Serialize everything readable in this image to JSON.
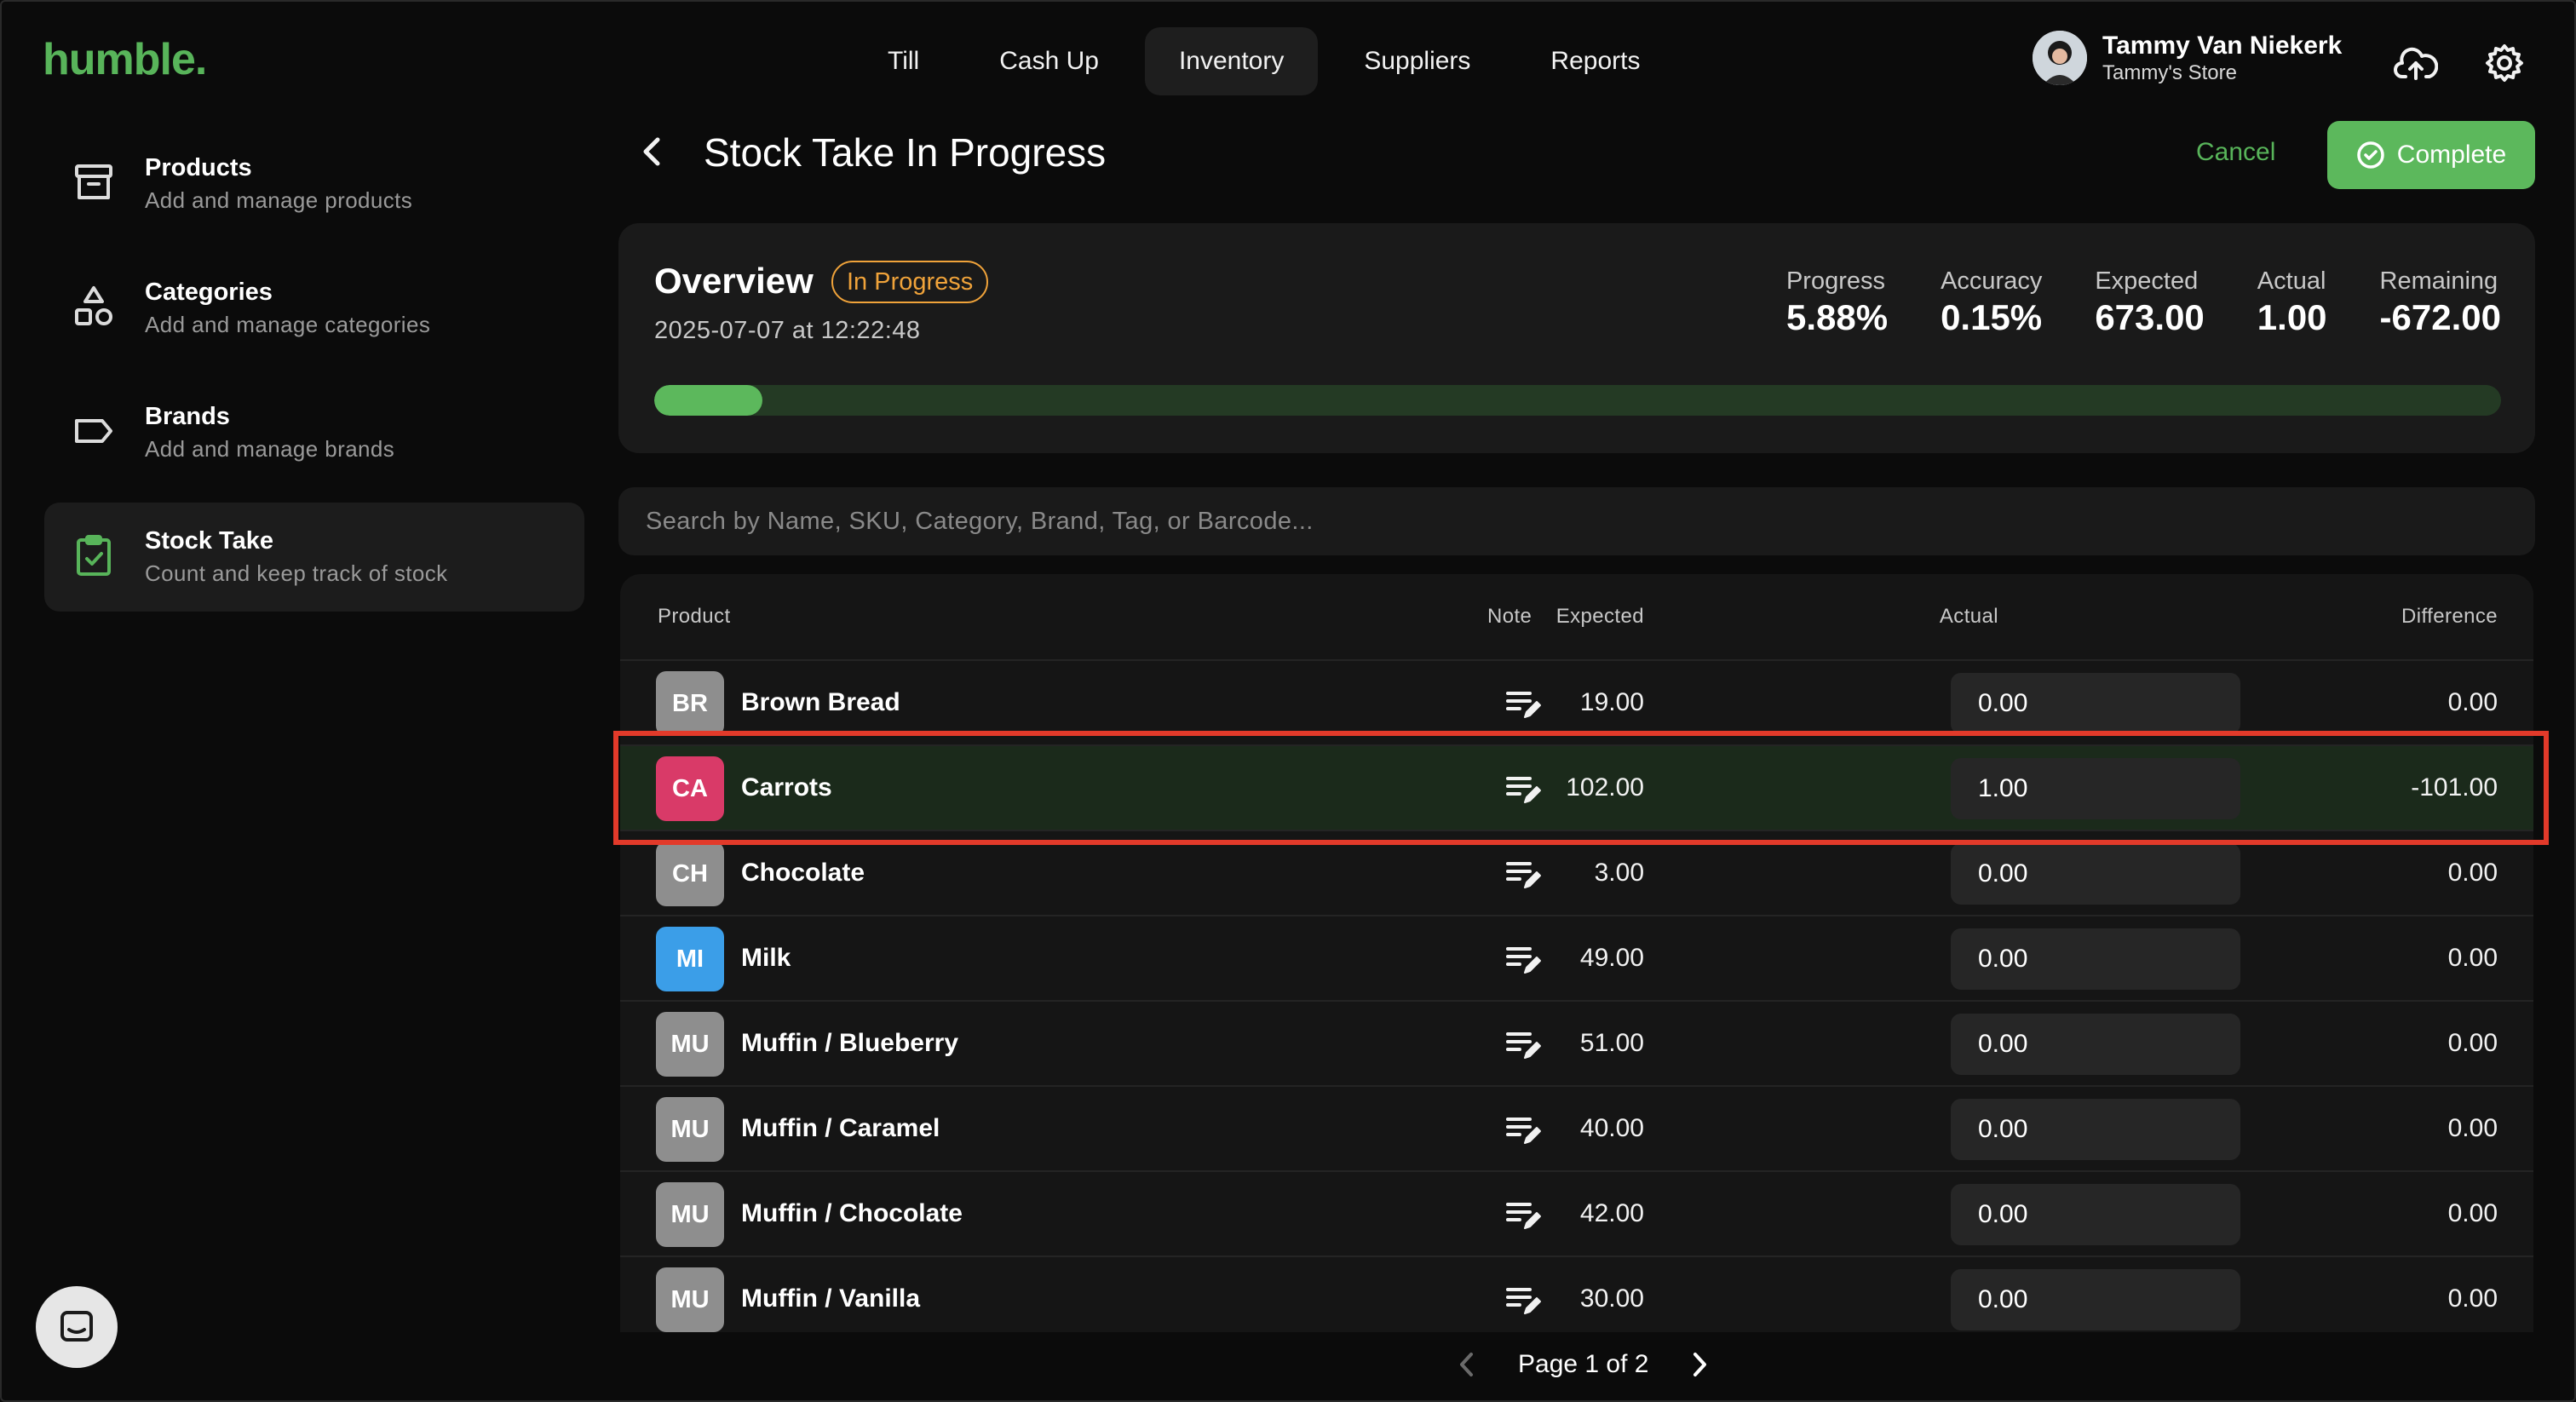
{
  "app": {
    "logo": "humble.",
    "nav": [
      "Till",
      "Cash Up",
      "Inventory",
      "Suppliers",
      "Reports"
    ],
    "active_nav": "Inventory",
    "user": {
      "name": "Tammy Van Niekerk",
      "store": "Tammy's Store"
    }
  },
  "sidebar": {
    "items": [
      {
        "title": "Products",
        "subtitle": "Add and manage products",
        "icon": "archive-box-icon"
      },
      {
        "title": "Categories",
        "subtitle": "Add and manage categories",
        "icon": "shapes-icon"
      },
      {
        "title": "Brands",
        "subtitle": "Add and manage brands",
        "icon": "tag-icon"
      },
      {
        "title": "Stock Take",
        "subtitle": "Count and keep track of stock",
        "icon": "clipboard-check-icon",
        "active": true
      }
    ]
  },
  "header": {
    "title": "Stock Take In Progress",
    "cancel_label": "Cancel",
    "complete_label": "Complete"
  },
  "overview": {
    "title": "Overview",
    "badge": "In Progress",
    "date": "2025-07-07 at 12:22:48",
    "stats": [
      {
        "label": "Progress",
        "value": "5.88%"
      },
      {
        "label": "Accuracy",
        "value": "0.15%"
      },
      {
        "label": "Expected",
        "value": "673.00"
      },
      {
        "label": "Actual",
        "value": "1.00"
      },
      {
        "label": "Remaining",
        "value": "-672.00"
      }
    ],
    "progress_fraction": 0.0588
  },
  "search": {
    "placeholder": "Search by Name, SKU, Category, Brand, Tag, or Barcode..."
  },
  "table": {
    "headers": {
      "product": "Product",
      "note": "Note",
      "expected": "Expected",
      "actual": "Actual",
      "difference": "Difference"
    },
    "rows": [
      {
        "initials": "BR",
        "name": "Brown Bread",
        "expected": "19.00",
        "actual": "0.00",
        "difference": "0.00",
        "color": "#8e8e8e"
      },
      {
        "initials": "CA",
        "name": "Carrots",
        "expected": "102.00",
        "actual": "1.00",
        "difference": "-101.00",
        "color": "#d93a68",
        "highlighted": true
      },
      {
        "initials": "CH",
        "name": "Chocolate",
        "expected": "3.00",
        "actual": "0.00",
        "difference": "0.00",
        "color": "#8e8e8e"
      },
      {
        "initials": "MI",
        "name": "Milk",
        "expected": "49.00",
        "actual": "0.00",
        "difference": "0.00",
        "color": "#3b9ee8"
      },
      {
        "initials": "MU",
        "name": "Muffin / Blueberry",
        "expected": "51.00",
        "actual": "0.00",
        "difference": "0.00",
        "color": "#8e8e8e"
      },
      {
        "initials": "MU",
        "name": "Muffin / Caramel",
        "expected": "40.00",
        "actual": "0.00",
        "difference": "0.00",
        "color": "#8e8e8e"
      },
      {
        "initials": "MU",
        "name": "Muffin / Chocolate",
        "expected": "42.00",
        "actual": "0.00",
        "difference": "0.00",
        "color": "#8e8e8e"
      },
      {
        "initials": "MU",
        "name": "Muffin / Vanilla",
        "expected": "30.00",
        "actual": "0.00",
        "difference": "0.00",
        "color": "#8e8e8e"
      }
    ]
  },
  "pagination": {
    "label": "Page 1 of 2"
  },
  "colors": {
    "brand": "#58b45a",
    "warning": "#f0a33a",
    "highlight": "#e23a2a"
  }
}
